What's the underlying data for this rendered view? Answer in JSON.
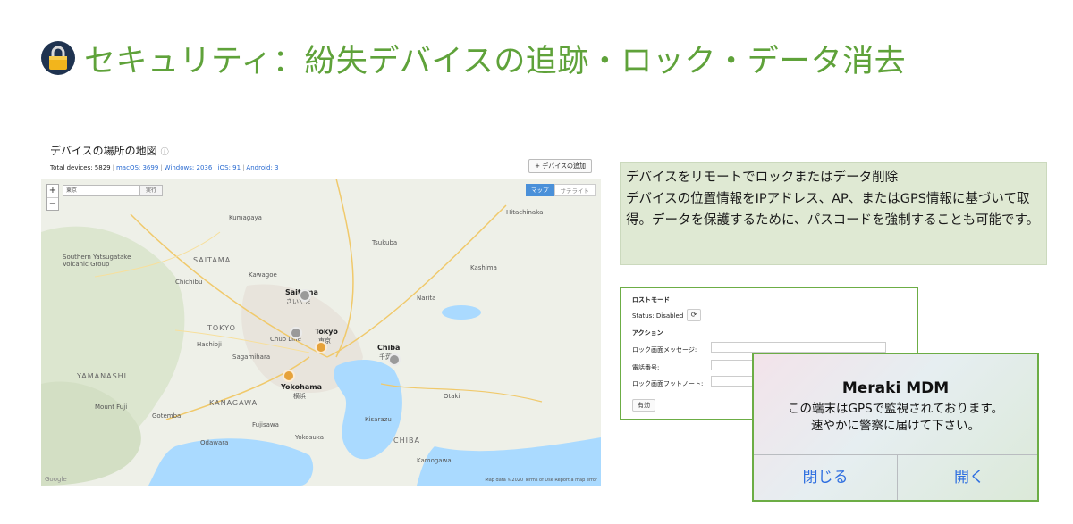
{
  "header": {
    "title": "セキュリティ：紛失デバイスの追跡・ロック・データ消去",
    "icon": "lock-icon",
    "badge_color": "#1f3350",
    "title_color": "#5fa23a"
  },
  "map_panel": {
    "title": "デバイスの場所の地図",
    "info_glyph": "ⓘ",
    "stats": {
      "total_label": "Total devices: 5829",
      "macos": "macOS: 3699",
      "windows": "Windows: 2036",
      "ios": "iOS: 91",
      "android": "Android: 3"
    },
    "add_device_label": "+ デバイスの追加",
    "zoom_in": "+",
    "zoom_out": "−",
    "search_value": "東京",
    "search_button": "実行",
    "toggle_map": "マップ",
    "toggle_satellite": "サテライト",
    "places": {
      "saitama": "SAITAMA",
      "tokyo_pref": "TOKYO",
      "yamanashi": "YAMANASHI",
      "kanagawa": "KANAGAWA",
      "chiba_pref": "CHIBA",
      "saitama_city": "Saitama",
      "saitama_city_jp": "さいたま",
      "tokyo_city": "Tokyo",
      "tokyo_city_jp": "東京",
      "chiba_city": "Chiba",
      "chiba_city_jp": "千葉",
      "yokohama": "Yokohama",
      "yokohama_jp": "横浜",
      "chichibu": "Chichibu",
      "hachioji": "Hachioji",
      "kawagoe": "Kawagoe",
      "sagamihara": "Sagamihara",
      "fujisawa": "Fujisawa",
      "odawara": "Odawara",
      "yokosuka": "Yokosuka",
      "kisarazu": "Kisarazu",
      "mount_fuji": "Mount Fuji",
      "gotemba": "Gotemba",
      "tsukuba": "Tsukuba",
      "kashima": "Kashima",
      "narita": "Narita",
      "kumagaya": "Kumagaya",
      "otaki": "Otaki",
      "kamogawa": "Kamogawa",
      "chuo_line": "Chuo Line",
      "southern_yatsugatake": "Southern Yatsugatake Volcanic Group",
      "hitachinaka": "Hitachinaka"
    },
    "pins": [
      {
        "color": "orange",
        "count": "1"
      },
      {
        "color": "orange",
        "count": "1"
      },
      {
        "color": "gray",
        "count": "1"
      },
      {
        "color": "gray",
        "count": "1"
      }
    ],
    "footer": "Map data ©2020   Terms of Use   Report a map error",
    "google": "Google"
  },
  "description": {
    "line1": "デバイスをリモートでロックまたはデータ削除",
    "line2": "デバイスの位置情報をIPアドレス、AP、またはGPS情報に基づいて取得。データを保護するために、パスコードを強制することも可能です。"
  },
  "lost_mode": {
    "heading": "ロストモード",
    "status": "Status: Disabled",
    "refresh_glyph": "⟳",
    "actions_heading": "アクション",
    "lock_message_label": "ロック画面メッセージ:",
    "phone_label": "電話番号:",
    "footnote_label": "ロック画面フットノート:",
    "run_button": "有効"
  },
  "dialog": {
    "title": "Meraki MDM",
    "message_line1": "この端末はGPSで監視されております。",
    "message_line2": "速やかに警察に届けて下さい。",
    "close_button": "閉じる",
    "open_button": "開く",
    "button_color": "#2f6fe0"
  }
}
